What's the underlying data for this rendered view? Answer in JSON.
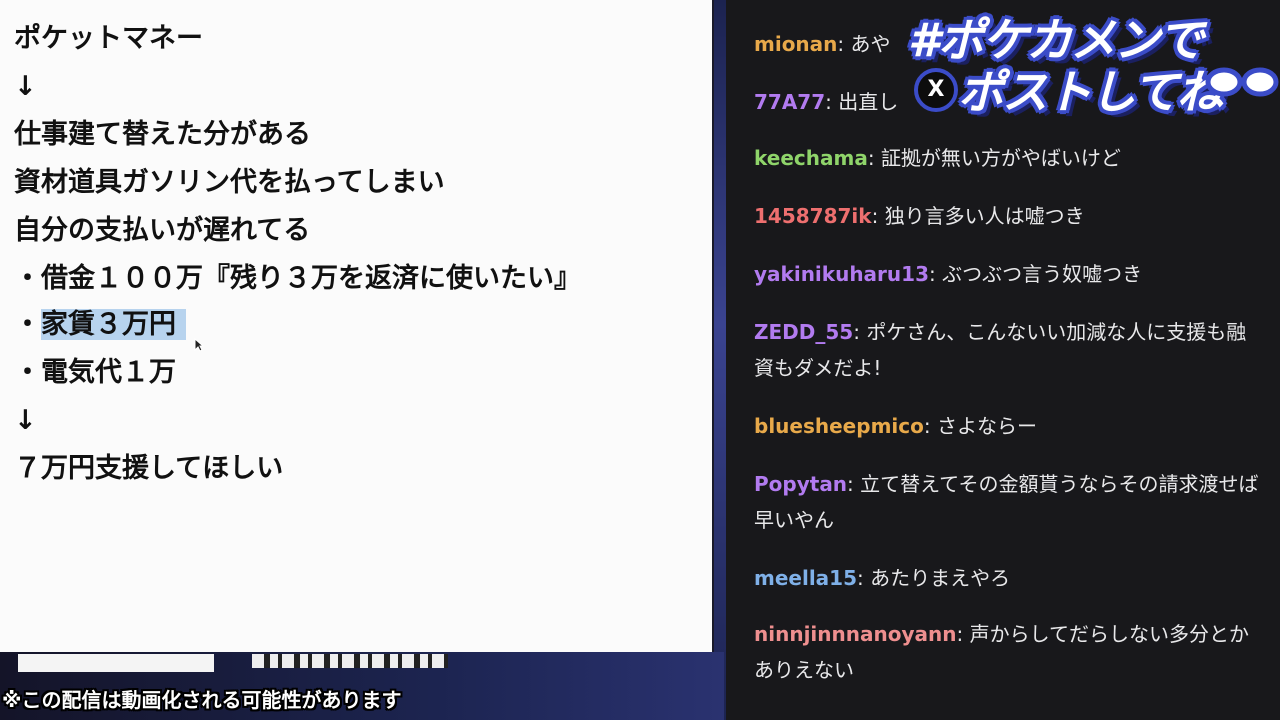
{
  "notepad": {
    "lines": [
      "ポケットマネー",
      "↓",
      "仕事建て替えた分がある",
      "資材道具ガソリン代を払ってしまい",
      "自分の支払いが遅れてる",
      "・借金１００万『残り３万を返済に使いたい』",
      "・",
      "家賃３万円",
      "・電気代１万",
      "↓",
      "７万円支援してほしい"
    ]
  },
  "overlay": {
    "disclaimer": "※この配信は動画化される可能性があります",
    "banner_line1": "#ポケカメンで",
    "banner_line2": "ポストしてね",
    "x_label": "X"
  },
  "chat": {
    "messages": [
      {
        "user": "mionan",
        "color": "#e8a94a",
        "text": "あや"
      },
      {
        "user": "77A77",
        "color": "#b27bf0",
        "text": "出直し"
      },
      {
        "user": "keechama",
        "color": "#8fd46a",
        "text": "証拠が無い方がやばいけど"
      },
      {
        "user": "1458787ik",
        "color": "#ee6f6f",
        "text": "独り言多い人は嘘つき"
      },
      {
        "user": "yakinikuharu13",
        "color": "#b27bf0",
        "text": "ぶつぶつ言う奴嘘つき"
      },
      {
        "user": "ZEDD_55",
        "color": "#b27bf0",
        "text": "ポケさん、こんないい加減な人に支援も融資もダメだよ!"
      },
      {
        "user": "bluesheepmico",
        "color": "#e8a94a",
        "text": "さよならー"
      },
      {
        "user": "Popytan",
        "color": "#b27bf0",
        "text": "立て替えてその金額貰うならその請求渡せば早いやん"
      },
      {
        "user": "meella15",
        "color": "#7fb0e8",
        "text": "あたりまえやろ"
      },
      {
        "user": "ninnjinnnanoyann",
        "color": "#ee8f8f",
        "text": "声からしてだらしない多分とかありえない"
      }
    ]
  }
}
